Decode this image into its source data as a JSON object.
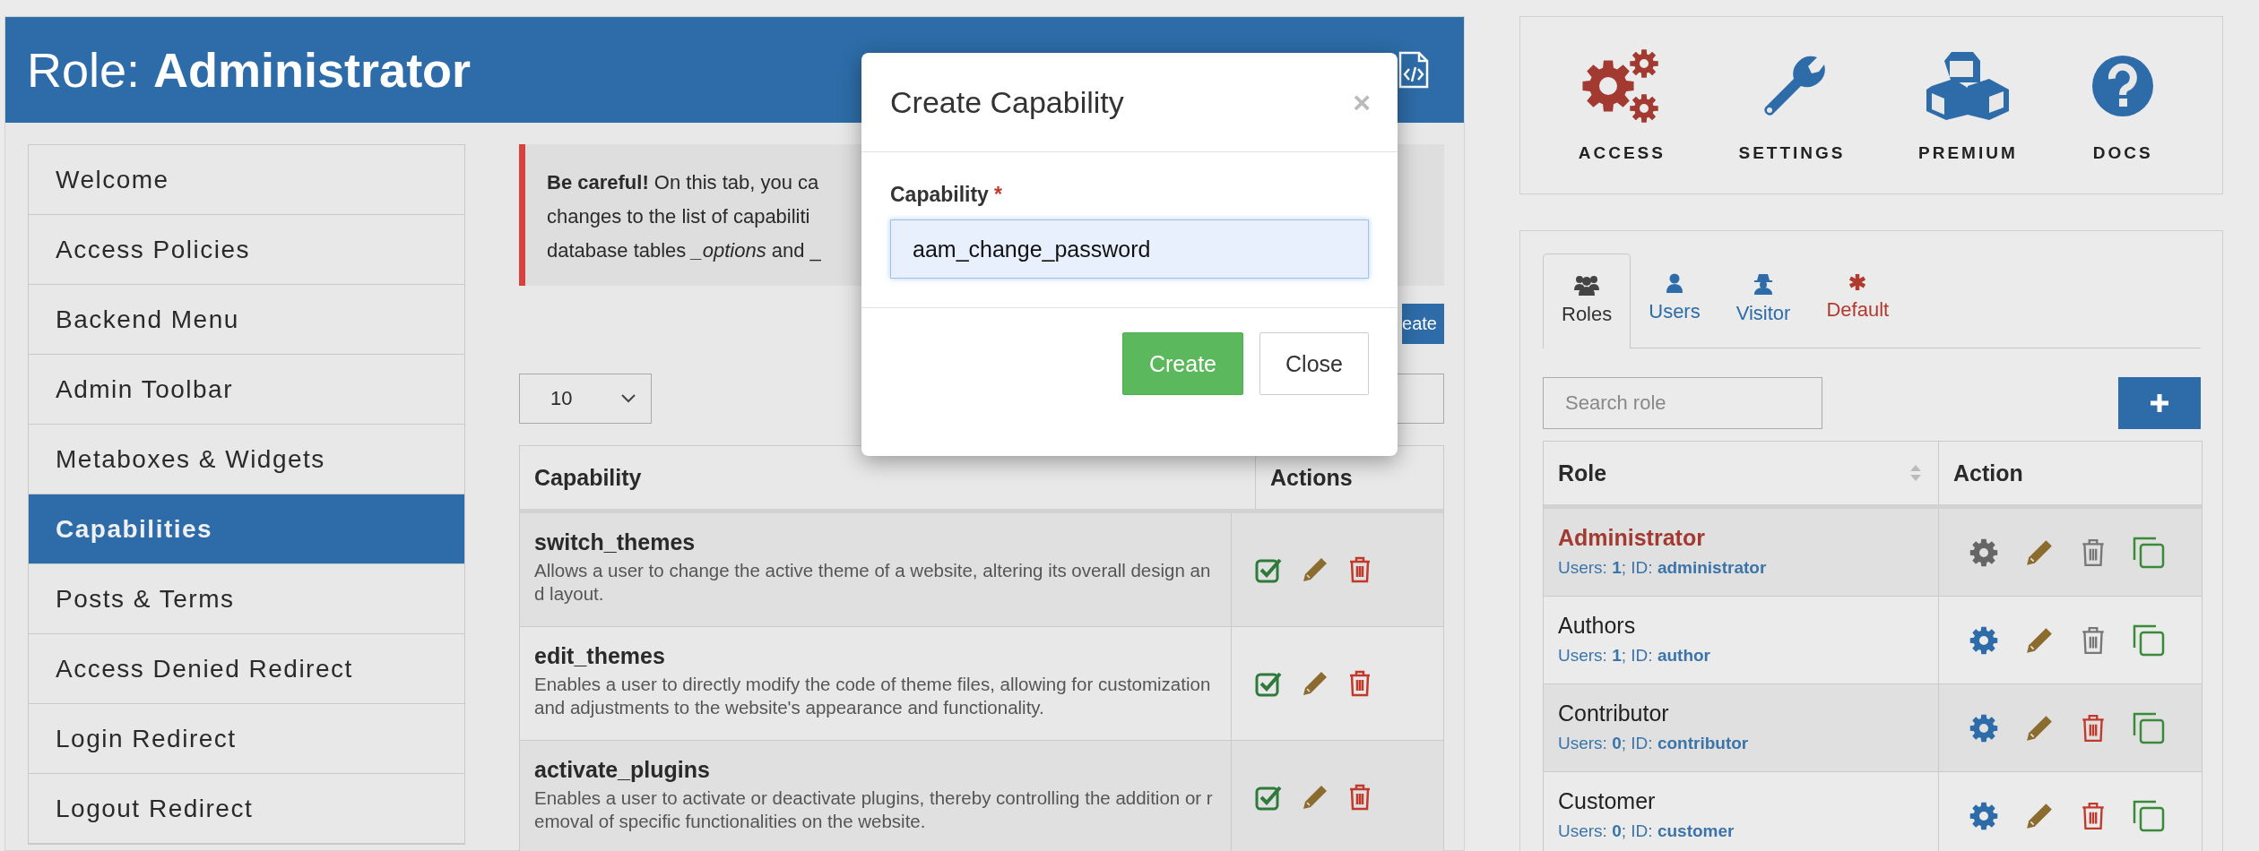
{
  "header": {
    "title": "Role: **Administrator**"
  },
  "sidebar": {
    "items": [
      {
        "label": "Welcome",
        "selected": false
      },
      {
        "label": "Access Policies",
        "selected": false
      },
      {
        "label": "Backend Menu",
        "selected": false
      },
      {
        "label": "Admin Toolbar",
        "selected": false
      },
      {
        "label": "Metaboxes & Widgets",
        "selected": false
      },
      {
        "label": "Capabilities",
        "selected": true
      },
      {
        "label": "Posts & Terms",
        "selected": false
      },
      {
        "label": "Access Denied Redirect",
        "selected": false
      },
      {
        "label": "Login Redirect",
        "selected": false
      },
      {
        "label": "Logout Redirect",
        "selected": false
      }
    ]
  },
  "alert": {
    "lines": [
      "**Be careful!** On this tab, you ca",
      "changes to the list of capabiliti",
      "database tables *_options* and _"
    ]
  },
  "create_button": {
    "label": "eate"
  },
  "page_size": {
    "value": "10"
  },
  "capabilities_table": {
    "columns": [
      "Capability",
      "Actions"
    ],
    "rows": [
      {
        "name": "switch_themes",
        "description": "Allows a user to change the active theme of a website, altering its overall design and layout."
      },
      {
        "name": "edit_themes",
        "description": "Enables a user to directly modify the code of theme files, allowing for customization and adjustments to the website's appearance and functionality."
      },
      {
        "name": "activate_plugins",
        "description": "Enables a user to activate or deactivate plugins, thereby controlling the addition or removal of specific functionalities on the website."
      }
    ]
  },
  "modal": {
    "title": "Create Capability",
    "close": "×",
    "field_label": "Capability",
    "required_mark": "*",
    "value": "aam_change_password",
    "buttons": [
      {
        "label": "Create",
        "kind": "primary"
      },
      {
        "label": "Close",
        "kind": "default"
      }
    ]
  },
  "top_nav": [
    {
      "label": "ACCESS",
      "kind": "access"
    },
    {
      "label": "SETTINGS",
      "kind": "settings"
    },
    {
      "label": "PREMIUM",
      "kind": "premium"
    },
    {
      "label": "DOCS",
      "kind": "docs"
    }
  ],
  "subject_tabs": [
    {
      "label": "Roles",
      "kind": "roles",
      "selected": true
    },
    {
      "label": "Users",
      "kind": "users",
      "selected": false
    },
    {
      "label": "Visitor",
      "kind": "visitor",
      "selected": false
    },
    {
      "label": "Default",
      "kind": "default",
      "selected": false
    }
  ],
  "role_search": {
    "placeholder": "Search role"
  },
  "roles_table": {
    "columns": [
      "Role",
      "Action"
    ],
    "rows": [
      {
        "name": "Administrator",
        "details": "Users: **1**; ID: **administrator**",
        "current": true,
        "deletable": false
      },
      {
        "name": "Authors",
        "details": "Users: **1**; ID: **author**",
        "current": false,
        "deletable": false
      },
      {
        "name": "Contributor",
        "details": "Users: **0**; ID: **contributor**",
        "current": false,
        "deletable": true
      },
      {
        "name": "Customer",
        "details": "Users: **0**; ID: **customer**",
        "current": false,
        "deletable": true
      }
    ]
  }
}
